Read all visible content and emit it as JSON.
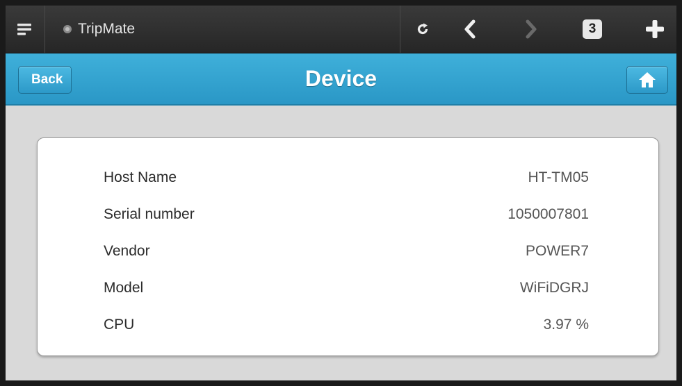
{
  "browser": {
    "tab_title": "TripMate",
    "tab_count": "3",
    "icons": {
      "menu": "menu-icon",
      "tab": "tab-dot-icon",
      "reload": "reload-icon",
      "back": "chevron-left-icon",
      "forward": "chevron-right-icon",
      "new_tab": "plus-icon"
    }
  },
  "header": {
    "back_label": "Back",
    "title": "Device",
    "home_icon": "home-icon",
    "accent_color": "#2a97c6"
  },
  "device_info": {
    "rows": [
      {
        "label": "Host Name",
        "value": "HT-TM05"
      },
      {
        "label": "Serial number",
        "value": "1050007801"
      },
      {
        "label": "Vendor",
        "value": "POWER7"
      },
      {
        "label": "Model",
        "value": "WiFiDGRJ"
      },
      {
        "label": "CPU",
        "value": "3.97 %"
      }
    ]
  }
}
